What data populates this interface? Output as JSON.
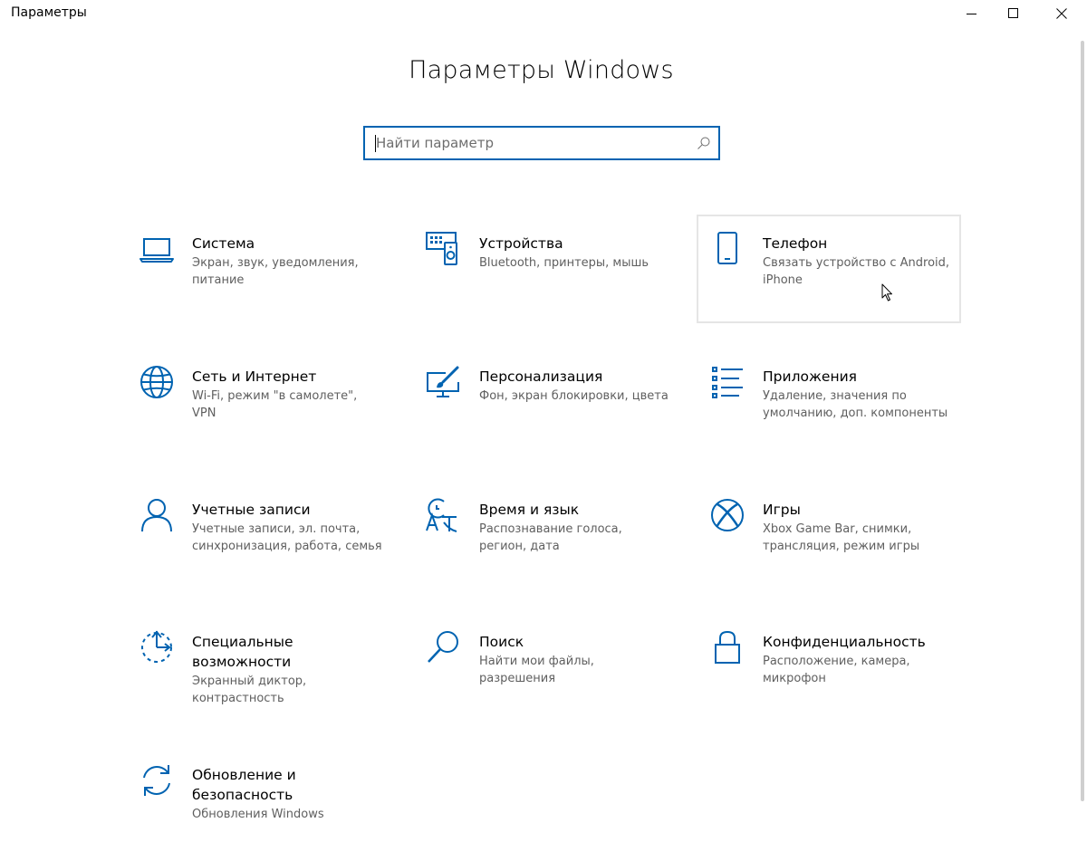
{
  "window": {
    "title": "Параметры"
  },
  "page": {
    "title": "Параметры Windows"
  },
  "search": {
    "placeholder": "Найти параметр",
    "value": ""
  },
  "accent_color": "#0063b1",
  "tiles": [
    {
      "name": "Система",
      "desc": "Экран, звук, уведомления, питание",
      "icon": "laptop-icon"
    },
    {
      "name": "Устройства",
      "desc": "Bluetooth, принтеры, мышь",
      "icon": "devices-icon"
    },
    {
      "name": "Телефон",
      "desc": "Связать устройство с Android, iPhone",
      "icon": "phone-icon"
    },
    {
      "name": "Сеть и Интернет",
      "desc": "Wi-Fi, режим \"в самолете\", VPN",
      "icon": "globe-icon"
    },
    {
      "name": "Персонализация",
      "desc": "Фон, экран блокировки, цвета",
      "icon": "personalization-icon"
    },
    {
      "name": "Приложения",
      "desc": "Удаление, значения по умолчанию, доп. компоненты",
      "icon": "apps-list-icon"
    },
    {
      "name": "Учетные записи",
      "desc": "Учетные записи, эл. почта, синхронизация, работа, семья",
      "icon": "person-icon"
    },
    {
      "name": "Время и язык",
      "desc": "Распознавание голоса, регион, дата",
      "icon": "time-language-icon"
    },
    {
      "name": "Игры",
      "desc": "Xbox Game Bar, снимки, трансляция, режим игры",
      "icon": "xbox-icon"
    },
    {
      "name": "Специальные возможности",
      "desc": "Экранный диктор, контрастность",
      "icon": "accessibility-icon"
    },
    {
      "name": "Поиск",
      "desc": "Найти мои файлы, разрешения",
      "icon": "search-icon"
    },
    {
      "name": "Конфиденциальность",
      "desc": "Расположение, камера, микрофон",
      "icon": "lock-icon"
    },
    {
      "name": "Обновление и безопасность",
      "desc": "Обновления Windows",
      "icon": "update-icon"
    }
  ]
}
